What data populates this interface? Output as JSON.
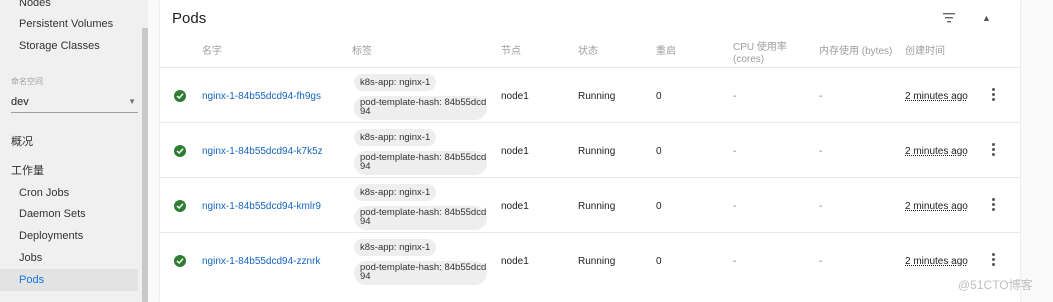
{
  "sidebar": {
    "items_top": [
      "Nodes",
      "Persistent Volumes",
      "Storage Classes"
    ],
    "namespace_label": "命名空间",
    "namespace_value": "dev",
    "overview": "概况",
    "workloads": "工作量",
    "workload_items": [
      "Cron Jobs",
      "Daemon Sets",
      "Deployments",
      "Jobs",
      "Pods"
    ],
    "active_item": "Pods"
  },
  "card": {
    "title": "Pods",
    "columns": {
      "name": "名字",
      "labels": "标签",
      "node": "节点",
      "status": "状态",
      "restarts": "重启",
      "cpu_line1": "CPU 使用率",
      "cpu_line2": "(cores)",
      "memory": "内存使用 (bytes)",
      "created": "创建时间"
    },
    "rows": [
      {
        "name": "nginx-1-84b55dcd94-fh9gs",
        "label1": "k8s-app: nginx-1",
        "label2": "pod-template-hash: 84b55dcd94",
        "node": "node1",
        "status": "Running",
        "restarts": "0",
        "cpu": "-",
        "memory": "-",
        "created": "2 minutes ago"
      },
      {
        "name": "nginx-1-84b55dcd94-k7k5z",
        "label1": "k8s-app: nginx-1",
        "label2": "pod-template-hash: 84b55dcd94",
        "node": "node1",
        "status": "Running",
        "restarts": "0",
        "cpu": "-",
        "memory": "-",
        "created": "2 minutes ago"
      },
      {
        "name": "nginx-1-84b55dcd94-kmlr9",
        "label1": "k8s-app: nginx-1",
        "label2": "pod-template-hash: 84b55dcd94",
        "node": "node1",
        "status": "Running",
        "restarts": "0",
        "cpu": "-",
        "memory": "-",
        "created": "2 minutes ago"
      },
      {
        "name": "nginx-1-84b55dcd94-zznrk",
        "label1": "k8s-app: nginx-1",
        "label2": "pod-template-hash: 84b55dcd94",
        "node": "node1",
        "status": "Running",
        "restarts": "0",
        "cpu": "-",
        "memory": "-",
        "created": "2 minutes ago"
      }
    ]
  },
  "watermark": "@51CTO博客",
  "colors": {
    "accent": "#1a73e8",
    "status_ok": "#2e7d32",
    "link": "#1565c0"
  },
  "chart_data": {
    "type": "table",
    "columns": [
      "名字",
      "标签",
      "节点",
      "状态",
      "重启",
      "CPU 使用率 (cores)",
      "内存使用 (bytes)",
      "创建时间"
    ],
    "rows": [
      [
        "nginx-1-84b55dcd94-fh9gs",
        "k8s-app: nginx-1; pod-template-hash: 84b55dcd94",
        "node1",
        "Running",
        "0",
        "-",
        "-",
        "2 minutes ago"
      ],
      [
        "nginx-1-84b55dcd94-k7k5z",
        "k8s-app: nginx-1; pod-template-hash: 84b55dcd94",
        "node1",
        "Running",
        "0",
        "-",
        "-",
        "2 minutes ago"
      ],
      [
        "nginx-1-84b55dcd94-kmlr9",
        "k8s-app: nginx-1; pod-template-hash: 84b55dcd94",
        "node1",
        "Running",
        "0",
        "-",
        "-",
        "2 minutes ago"
      ],
      [
        "nginx-1-84b55dcd94-zznrk",
        "k8s-app: nginx-1; pod-template-hash: 84b55dcd94",
        "node1",
        "Running",
        "0",
        "-",
        "-",
        "2 minutes ago"
      ]
    ]
  }
}
